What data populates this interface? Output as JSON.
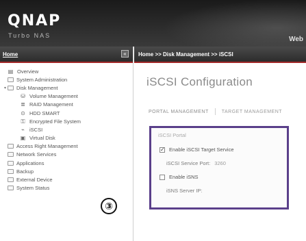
{
  "header": {
    "logo": "QNAP",
    "tagline": "Turbo NAS",
    "link": "Web"
  },
  "sidebar": {
    "title": "Home",
    "collapse_label": "«",
    "items": [
      {
        "label": "Overview",
        "level": 0,
        "icon": "overview-icon",
        "glyph": "▤"
      },
      {
        "label": "System Administration",
        "level": 0,
        "icon": "folder-icon"
      },
      {
        "label": "Disk Management",
        "level": 0,
        "icon": "folder-open-icon",
        "expanded": true
      },
      {
        "label": "Volume Management",
        "level": 1,
        "icon": "volume-icon",
        "glyph": "⛁"
      },
      {
        "label": "RAID Management",
        "level": 1,
        "icon": "raid-icon",
        "glyph": "≣"
      },
      {
        "label": "HDD SMART",
        "level": 1,
        "icon": "hdd-smart-icon",
        "glyph": "⊙"
      },
      {
        "label": "Encrypted File System",
        "level": 1,
        "icon": "lock-icon",
        "glyph": "⚿"
      },
      {
        "label": "iSCSI",
        "level": 1,
        "icon": "iscsi-icon",
        "glyph": "⌁"
      },
      {
        "label": "Virtual Disk",
        "level": 1,
        "icon": "virtual-disk-icon",
        "glyph": "▣"
      },
      {
        "label": "Access Right Management",
        "level": 0,
        "icon": "folder-icon"
      },
      {
        "label": "Network Services",
        "level": 0,
        "icon": "folder-icon"
      },
      {
        "label": "Applications",
        "level": 0,
        "icon": "folder-icon"
      },
      {
        "label": "Backup",
        "level": 0,
        "icon": "folder-icon"
      },
      {
        "label": "External Device",
        "level": 0,
        "icon": "folder-icon"
      },
      {
        "label": "System Status",
        "level": 0,
        "icon": "folder-icon"
      }
    ],
    "step_badge": "③"
  },
  "content": {
    "breadcrumb": "Home >> Disk Management >> iSCSI",
    "page_title": "iSCSI Configuration",
    "tabs": [
      {
        "label": "PORTAL MANAGEMENT",
        "active": true
      },
      {
        "label": "TARGET MANAGEMENT",
        "active": false
      }
    ],
    "panel": {
      "legend": "iSCSI Portal",
      "enable_iscsi_label": "Enable iSCSI Target Service",
      "enable_iscsi_checked": true,
      "service_port_label": "iSCSI Service Port:",
      "service_port_value": "3260",
      "enable_isns_label": "Enable iSNS",
      "enable_isns_checked": false,
      "isns_server_label": "iSNS Server IP:"
    }
  },
  "colors": {
    "header_bg": "#2b2b2b",
    "accent_border": "#5a3f8a",
    "breadcrumb_underline": "#a42a2a"
  }
}
